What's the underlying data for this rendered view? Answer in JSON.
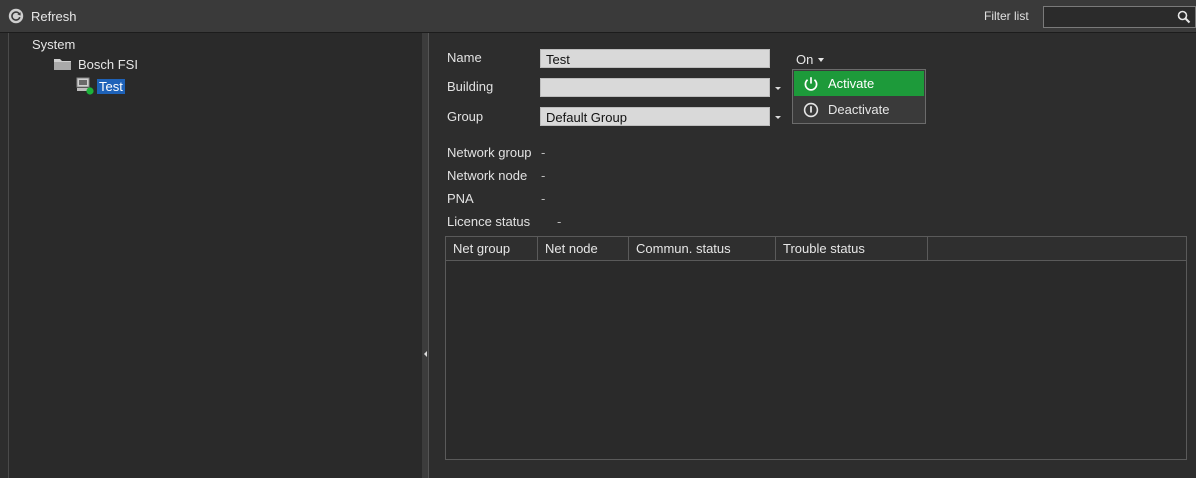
{
  "toolbar": {
    "refresh_label": "Refresh",
    "refresh_icon": "refresh-icon",
    "filter_label": "Filter list",
    "filter_value": "",
    "search_icon": "search-icon"
  },
  "tree": {
    "root_label": "System",
    "node1_label": "Bosch FSI",
    "node2_label": "Test"
  },
  "form": {
    "name_label": "Name",
    "name_value": "Test",
    "building_label": "Building",
    "building_value": "",
    "group_label": "Group",
    "group_value": "Default Group",
    "network_group_label": "Network group",
    "network_group_value": "-",
    "network_node_label": "Network node",
    "network_node_value": "-",
    "pna_label": "PNA",
    "pna_value": "-",
    "licence_status_label": "Licence status",
    "licence_status_value": "-"
  },
  "on_button": {
    "label": "On"
  },
  "menu": {
    "activate_label": "Activate",
    "deactivate_label": "Deactivate"
  },
  "table": {
    "columns": [
      "Net group",
      "Net node",
      "Commun. status",
      "Trouble status"
    ]
  },
  "colors": {
    "accent_active": "#1d9a3a",
    "selection": "#1e62b8",
    "background": "#2d2d2d"
  }
}
